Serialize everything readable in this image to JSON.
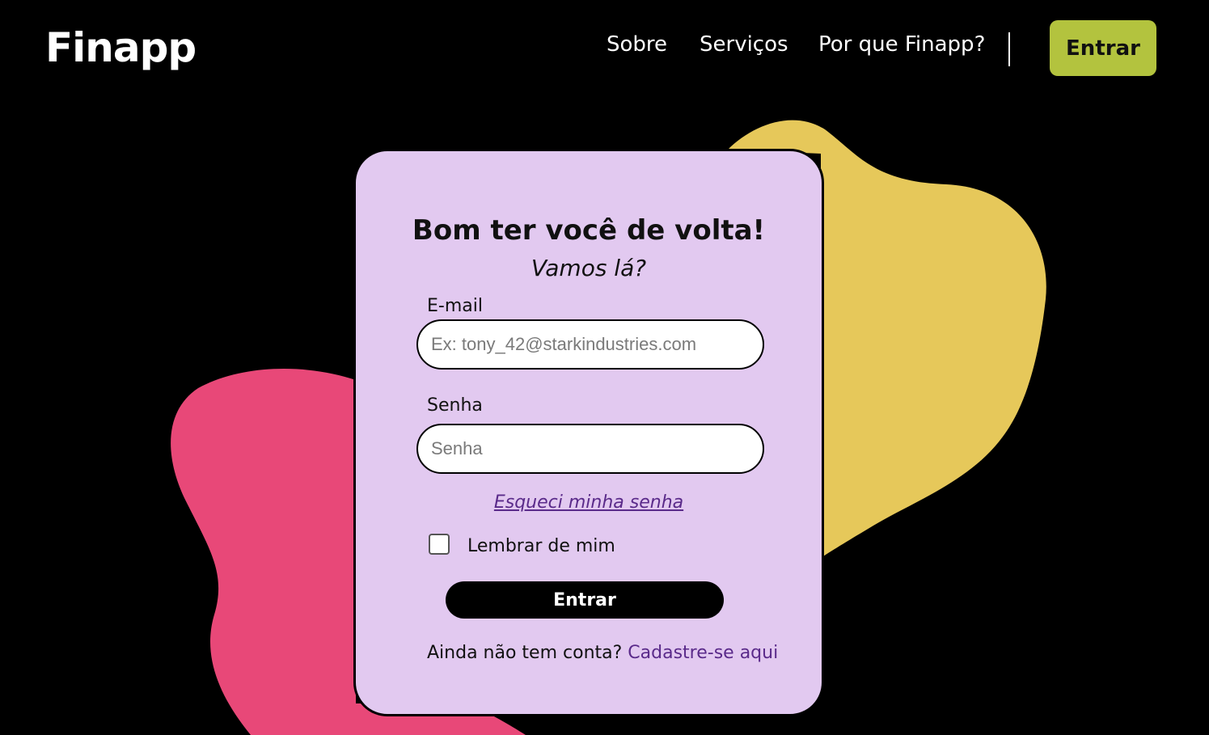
{
  "brand": {
    "logo": "Finapp"
  },
  "nav": {
    "items": [
      {
        "label": "Sobre"
      },
      {
        "label": "Serviços"
      },
      {
        "label": "Por que Finapp?"
      }
    ],
    "login_button": "Entrar"
  },
  "login_card": {
    "title": "Bom ter você de volta!",
    "subtitle": "Vamos lá?",
    "email_label": "E-mail",
    "email_placeholder": "Ex: tony_42@starkindustries.com",
    "email_value": "",
    "password_label": "Senha",
    "password_placeholder": "Senha",
    "password_value": "",
    "forgot_link": "Esqueci minha senha",
    "remember_label": "Lembrar de mim",
    "remember_checked": false,
    "submit_label": "Entrar",
    "signup_prompt": "Ainda não tem conta?",
    "signup_link": "Cadastre-se aqui"
  },
  "colors": {
    "background": "#000000",
    "card": "#e2c9f0",
    "accent_button": "#b3c33e",
    "blob_yellow": "#e6c85a",
    "blob_pink": "#e84878",
    "link": "#5a2a8a"
  }
}
